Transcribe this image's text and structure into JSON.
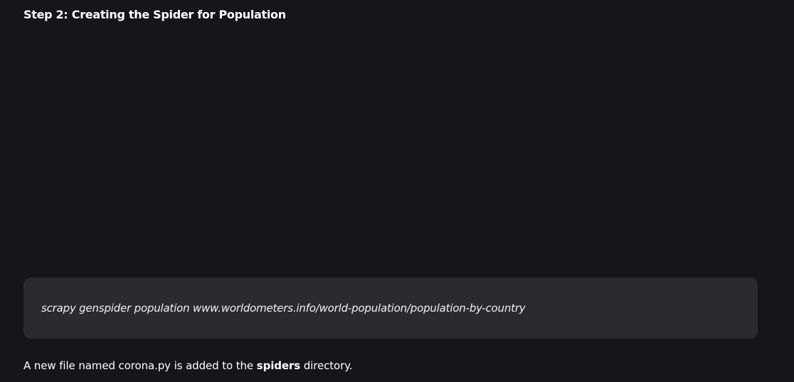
{
  "article": {
    "heading": "Step 2: Creating the Spider for Population",
    "code": "scrapy genspider population www.worldometers.info/world-population/population-by-country",
    "description": {
      "before": "A new file named corona.py is added to the ",
      "emphasis": "spiders",
      "after": " directory."
    }
  },
  "colors": {
    "background": "#151619",
    "code_background": "#2a2b2f",
    "text": "#ffffff"
  }
}
